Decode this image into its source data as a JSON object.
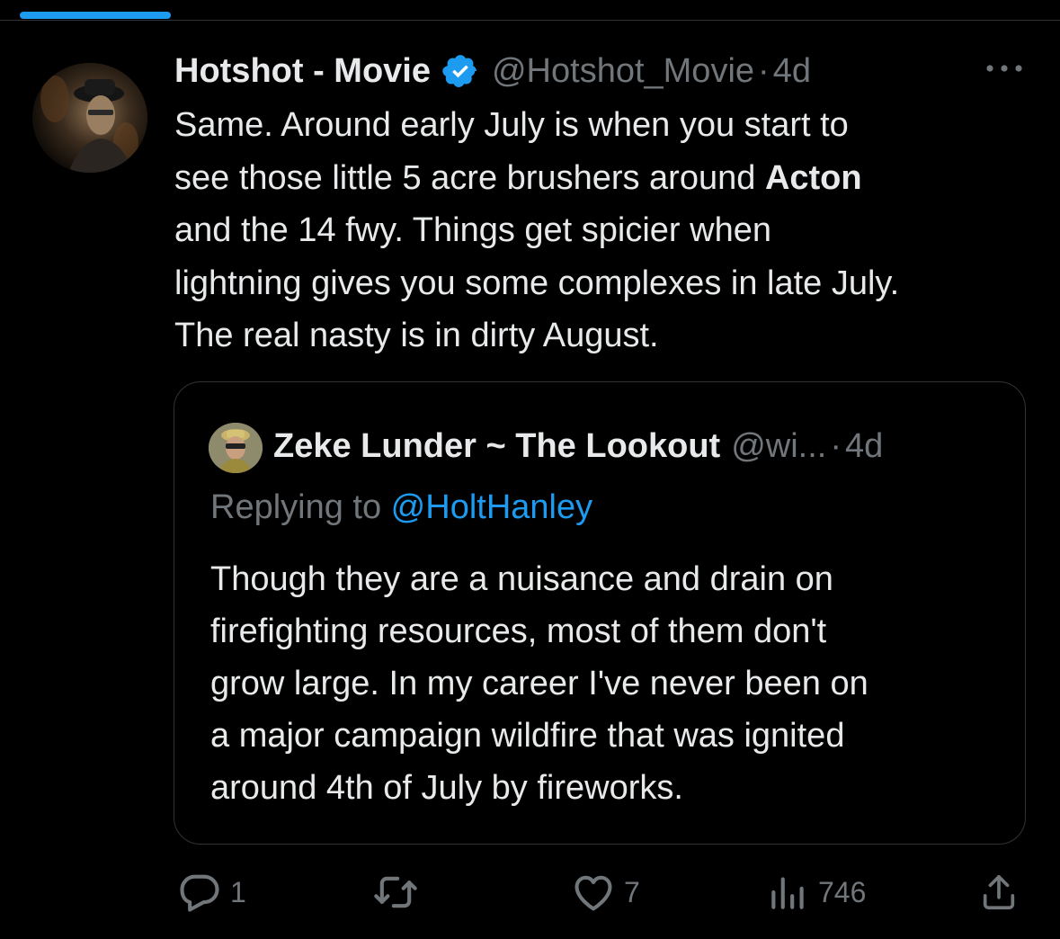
{
  "colors": {
    "background": "#000000",
    "text_primary": "#e7e9ea",
    "text_secondary": "#71767b",
    "accent": "#1d9bf0",
    "border": "#2f3336"
  },
  "tweet": {
    "author": {
      "display_name": "Hotshot - Movie",
      "handle": "@Hotshot_Movie",
      "verified_icon": "verified-badge-icon"
    },
    "separator": "·",
    "time": "4d",
    "more_icon": "more-horizontal-icon",
    "text_lines": [
      {
        "before": "Same. Around early July is when you start to",
        "bold": "",
        "after": ""
      },
      {
        "before": "see those little 5 acre brushers around ",
        "bold": "Acton",
        "after": ""
      },
      {
        "before": "and the 14 fwy. Things get spicier when",
        "bold": "",
        "after": ""
      },
      {
        "before": "lightning gives you some complexes in late July.",
        "bold": "",
        "after": ""
      },
      {
        "before": "The real nasty is in dirty August.",
        "bold": "",
        "after": ""
      }
    ]
  },
  "quoted_tweet": {
    "author": {
      "display_name": "Zeke Lunder ~ The Lookout",
      "handle": "@wi..."
    },
    "separator": "·",
    "time": "4d",
    "replying_prefix": "Replying to ",
    "replying_to": "@HoltHanley",
    "text_lines": [
      "Though they are a nuisance and drain on",
      "firefighting resources, most of them don't",
      "grow large. In my career I've never been on",
      "a major campaign wildfire that was ignited",
      "around 4th of July by fireworks."
    ]
  },
  "actions": {
    "reply": {
      "icon": "reply-icon",
      "count": "1"
    },
    "retweet": {
      "icon": "retweet-icon",
      "count": ""
    },
    "like": {
      "icon": "heart-icon",
      "count": "7"
    },
    "views": {
      "icon": "views-chart-icon",
      "count": "746"
    },
    "share": {
      "icon": "share-icon",
      "count": ""
    }
  }
}
